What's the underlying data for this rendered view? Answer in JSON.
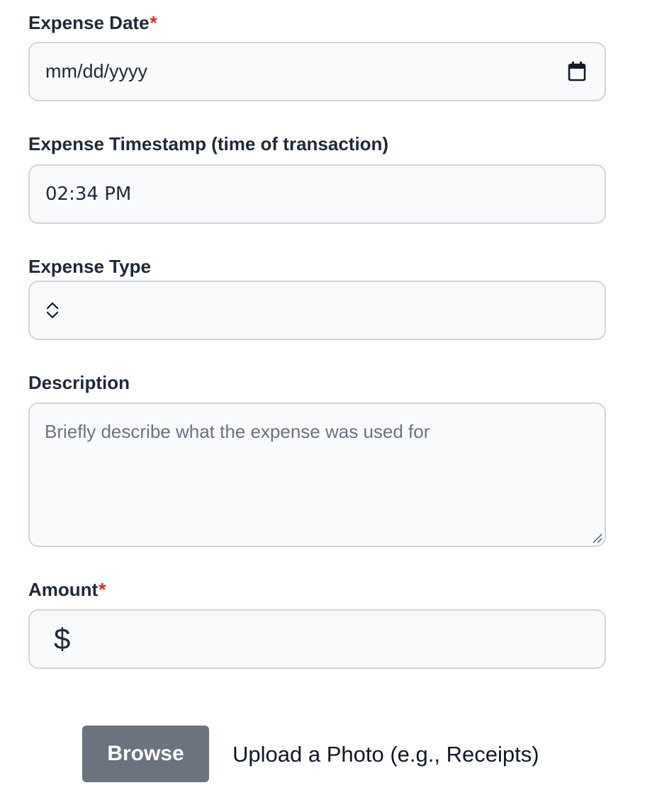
{
  "expense_date": {
    "label": "Expense Date",
    "required_mark": "*",
    "placeholder": "mm/dd/yyyy",
    "icon": "calendar-icon"
  },
  "expense_timestamp": {
    "label": "Expense Timestamp (time of transaction)",
    "value": "02:34 PM"
  },
  "expense_type": {
    "label": "Expense Type",
    "value": "",
    "icon": "chevron-updown-icon"
  },
  "description": {
    "label": "Description",
    "placeholder": "Briefly describe what the expense was used for",
    "value": ""
  },
  "amount": {
    "label": "Amount",
    "required_mark": "*",
    "currency_symbol": "$",
    "value": ""
  },
  "upload": {
    "button_label": "Browse",
    "label": "Upload a Photo (e.g., Receipts)"
  },
  "colors": {
    "required": "#dc2626",
    "field_bg": "#f9fafb",
    "field_border": "#d1d5db",
    "button_bg": "#6b7280"
  }
}
